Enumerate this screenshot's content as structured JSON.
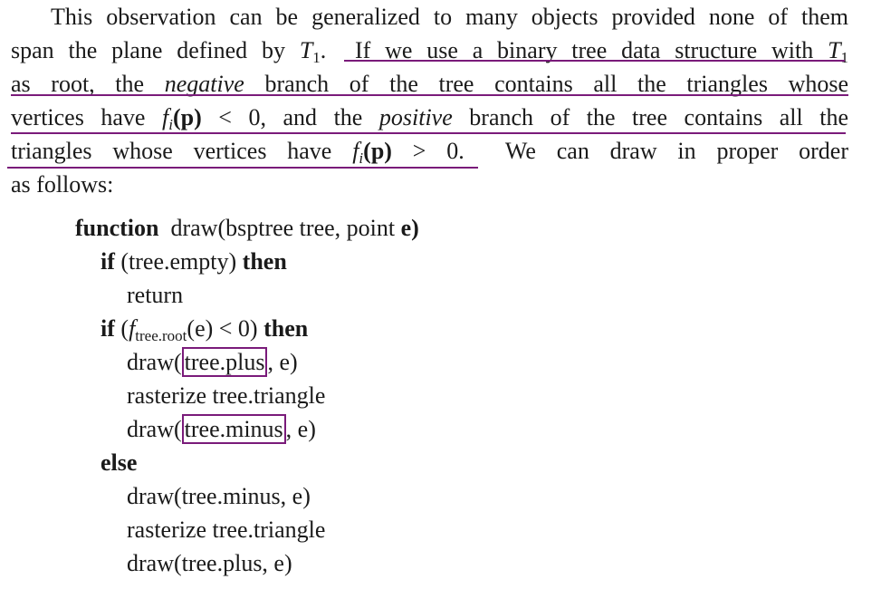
{
  "paragraph": {
    "line1": "This observation can be generalized to many objects provided none of them",
    "line2a": "span the plane defined by",
    "line2_t1": "T",
    "line2_sub": "1",
    "line2b": ".",
    "line2c": "If we use a binary tree data structure with",
    "line2_t1b": "T",
    "line2_sub_b": "1",
    "line3a": "as root, the",
    "line3_neg": "negative",
    "line3b": "branch of the tree contains all the triangles whose",
    "line4a": "vertices have",
    "line4_f": "f",
    "line4_i": "i",
    "line4_p": "(p)",
    "line4_lt": "< 0,",
    "line4b": "and the",
    "line4_pos": "positive",
    "line4c": "branch of the tree contains all the",
    "line5a": "triangles whose vertices have",
    "line5_f": "f",
    "line5_i": "i",
    "line5_p": "(p)",
    "line5_gt": "> 0.",
    "line5b": "We can draw in proper order",
    "line6": "as follows:"
  },
  "code": {
    "l1_kw": "function",
    "l1_rest": "draw(bsptree tree, point",
    "l1_e": "e)",
    "l2_kw": "if",
    "l2_mid": "(tree.empty)",
    "l2_then": "then",
    "l3": "return",
    "l4_kw": "if",
    "l4_open": "(",
    "l4_f": "f",
    "l4_sub": "tree.root",
    "l4_arg": "(e) < 0)",
    "l4_then": "then",
    "l5_pre": "draw(",
    "l5_box": "tree.plus",
    "l5_post": ", e)",
    "l6": "rasterize tree.triangle",
    "l7_pre": "draw(",
    "l7_box": "tree.minus",
    "l7_post": ", e)",
    "l8_kw": "else",
    "l9": "draw(tree.minus, e)",
    "l10": "rasterize tree.triangle",
    "l11": "draw(tree.plus, e)"
  },
  "annotation_color": "#7a1b7a"
}
